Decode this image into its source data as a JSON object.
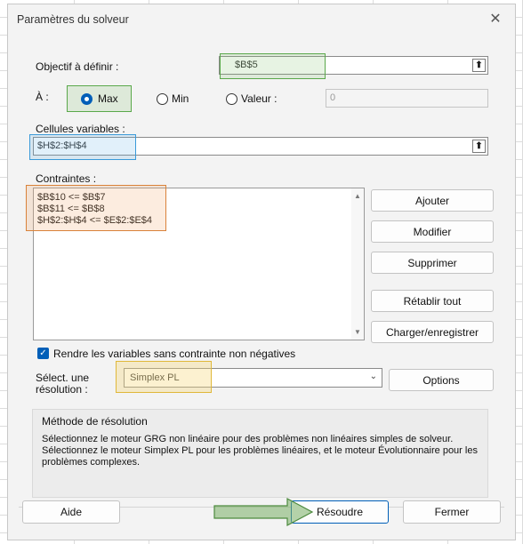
{
  "window": {
    "title": "Paramètres du solveur",
    "close_glyph": "✕"
  },
  "objective": {
    "label": "Objectif à définir :",
    "value": "$B$5"
  },
  "to": {
    "label": "À :",
    "options": [
      {
        "label": "Max",
        "selected": true
      },
      {
        "label": "Min",
        "selected": false
      },
      {
        "label": "Valeur :",
        "selected": false
      }
    ],
    "value_field": "0"
  },
  "variables": {
    "label": "Cellules variables :",
    "value": "$H$2:$H$4"
  },
  "constraints": {
    "label": "Contraintes :",
    "items": [
      "$B$10 <= $B$7",
      "$B$11 <= $B$8",
      "$H$2:$H$4 <= $E$2:$E$4"
    ]
  },
  "buttons": {
    "add": "Ajouter",
    "modify": "Modifier",
    "delete": "Supprimer",
    "reset": "Rétablir tout",
    "load_save": "Charger/enregistrer",
    "options": "Options",
    "help": "Aide",
    "solve": "Résoudre",
    "close": "Fermer"
  },
  "nonneg": {
    "label": "Rendre les variables sans contrainte non négatives",
    "checked": true
  },
  "engine": {
    "label_line1": "Sélect. une",
    "label_line2": "résolution :",
    "value": "Simplex PL"
  },
  "method": {
    "title": "Méthode de résolution",
    "description": "Sélectionnez le moteur GRG non linéaire pour des problèmes non linéaires simples de solveur. Sélectionnez le moteur Simplex PL pour les problèmes linéaires, et le moteur Évolutionnaire pour les problèmes complexes."
  },
  "annotation_colors": {
    "objective": "#5aa84a",
    "max": "#5aa84a",
    "variables": "#3a9ad9",
    "constraints": "#d9823a",
    "engine": "#e0b83a",
    "arrow": "#4d8a3e"
  },
  "icons": [
    "close-icon",
    "range-picker-icon",
    "chevron-down-icon",
    "checkbox-checked-icon",
    "scroll-up-icon",
    "scroll-down-icon",
    "arrow-annotation"
  ]
}
